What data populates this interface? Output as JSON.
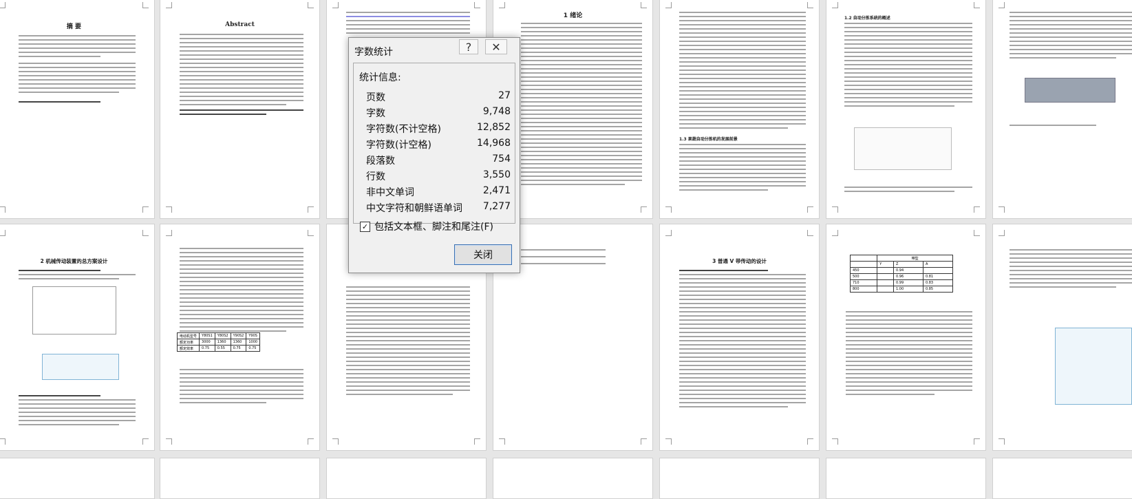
{
  "pages": {
    "page1_title": "摘 要",
    "page2_title": "Abstract",
    "page4_title": "1 绪论",
    "page9_title": "2 机械传动装置的总方案设计",
    "page12_title": "3 普通 V 带传动的设计",
    "page6_heading": "1.2 自动分拣系统的概述",
    "page5_heading": "1.3 果蔬自动分拣机的发展前景"
  },
  "dialog": {
    "title": "字数统计",
    "group_label": "统计信息:",
    "stats": [
      {
        "label": "页数",
        "value": "27"
      },
      {
        "label": "字数",
        "value": "9,748"
      },
      {
        "label": "字符数(不计空格)",
        "value": "12,852"
      },
      {
        "label": "字符数(计空格)",
        "value": "14,968"
      },
      {
        "label": "段落数",
        "value": "754"
      },
      {
        "label": "行数",
        "value": "3,550"
      },
      {
        "label": "非中文单词",
        "value": "2,471"
      },
      {
        "label": "中文字符和朝鲜语单词",
        "value": "7,277"
      }
    ],
    "include_label": "包括文本框、脚注和尾注(F)",
    "include_checked": "✓",
    "close_label": "关闭",
    "help_icon": "?",
    "close_icon": "✕"
  },
  "table_page8": {
    "rows": [
      [
        "电动机型号",
        "Y80S1",
        "Y80S2",
        "Y90S2",
        "Y90S"
      ],
      [
        "额定功率",
        "3000",
        "1360",
        "1360",
        "1000"
      ],
      [
        "额定效率",
        "0.75",
        "0.55",
        "0.75",
        "0.75"
      ]
    ]
  },
  "table_page14": {
    "rows": [
      [
        "",
        "带型"
      ],
      [
        "Y",
        "Z",
        "A"
      ],
      [
        "450",
        "",
        "0.94",
        ""
      ],
      [
        "500",
        "",
        "0.96",
        "0.81"
      ],
      [
        "710",
        "",
        "0.99",
        "0.83"
      ],
      [
        "800",
        "",
        "1.00",
        "0.85"
      ]
    ]
  }
}
